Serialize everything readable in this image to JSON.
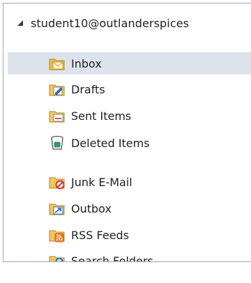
{
  "account": {
    "label": "student10@outlanderspices"
  },
  "folders": [
    {
      "label": "Inbox",
      "icon": "inbox-folder-icon",
      "selected": true
    },
    {
      "label": "Drafts",
      "icon": "drafts-folder-icon"
    },
    {
      "label": "Sent Items",
      "icon": "sent-items-folder-icon"
    },
    {
      "label": "Deleted Items",
      "icon": "deleted-items-trash-icon"
    },
    {
      "label": "Junk E-Mail",
      "icon": "junk-email-folder-icon"
    },
    {
      "label": "Outbox",
      "icon": "outbox-folder-icon"
    },
    {
      "label": "RSS Feeds",
      "icon": "rss-feeds-folder-icon"
    },
    {
      "label": "Search Folders",
      "icon": "search-folders-icon"
    }
  ],
  "colors": {
    "selection": "#dde3ec",
    "border": "#9aa6b5",
    "folder": "#f2c65a"
  }
}
